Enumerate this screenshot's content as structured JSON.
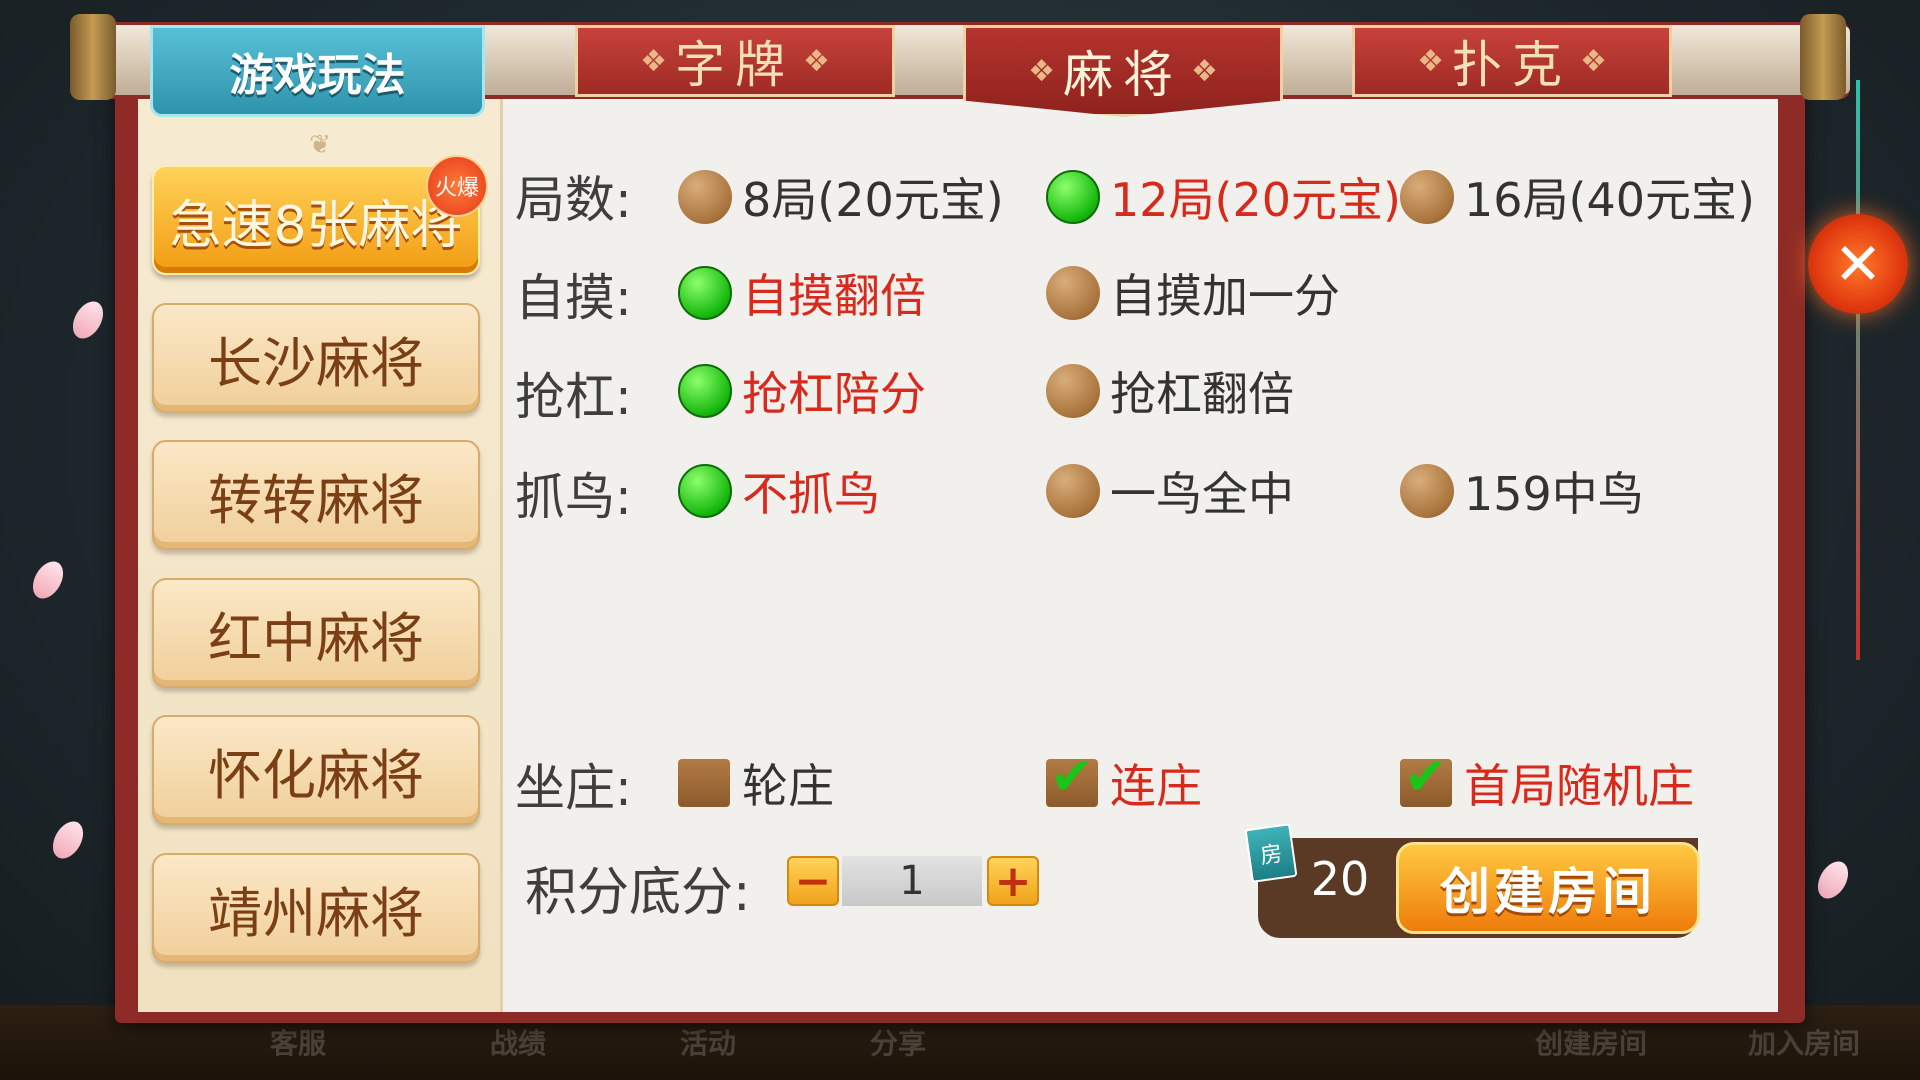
{
  "background": {
    "bottom_items": [
      "客服",
      "战绩",
      "活动",
      "分享",
      "创建房间",
      "加入房间"
    ]
  },
  "header": {
    "play_tab_label": "游戏玩法",
    "category_tabs": [
      {
        "label": "字牌",
        "active": false
      },
      {
        "label": "麻将",
        "active": true
      },
      {
        "label": "扑克",
        "active": false
      }
    ]
  },
  "modes": [
    {
      "label": "急速8张麻将",
      "selected": true,
      "badge": "火爆"
    },
    {
      "label": "长沙麻将",
      "selected": false
    },
    {
      "label": "转转麻将",
      "selected": false
    },
    {
      "label": "红中麻将",
      "selected": false
    },
    {
      "label": "怀化麻将",
      "selected": false
    },
    {
      "label": "靖州麻将",
      "selected": false
    }
  ],
  "rules": {
    "rounds": {
      "label": "局数:",
      "options": [
        {
          "label": "8局(20元宝)",
          "selected": false
        },
        {
          "label": "12局(20元宝)",
          "selected": true
        },
        {
          "label": "16局(40元宝)",
          "selected": false
        }
      ]
    },
    "self_draw": {
      "label": "自摸:",
      "options": [
        {
          "label": "自摸翻倍",
          "selected": true
        },
        {
          "label": "自摸加一分",
          "selected": false
        }
      ]
    },
    "rob_kong": {
      "label": "抢杠:",
      "options": [
        {
          "label": "抢杠陪分",
          "selected": true
        },
        {
          "label": "抢杠翻倍",
          "selected": false
        }
      ]
    },
    "catch_bird": {
      "label": "抓鸟:",
      "options": [
        {
          "label": "不抓鸟",
          "selected": true
        },
        {
          "label": "一鸟全中",
          "selected": false
        },
        {
          "label": "159中鸟",
          "selected": false
        }
      ]
    },
    "dealer": {
      "label": "坐庄:",
      "options": [
        {
          "label": "轮庄",
          "checked": false
        },
        {
          "label": "连庄",
          "checked": true
        },
        {
          "label": "首局随机庄",
          "checked": true
        }
      ]
    }
  },
  "score": {
    "label": "积分底分:",
    "minus": "−",
    "plus": "+",
    "value": "1"
  },
  "create_room": {
    "icon_text": "房",
    "cost": "20",
    "button_label": "创建房间"
  },
  "close": {
    "symbol": "✕"
  }
}
